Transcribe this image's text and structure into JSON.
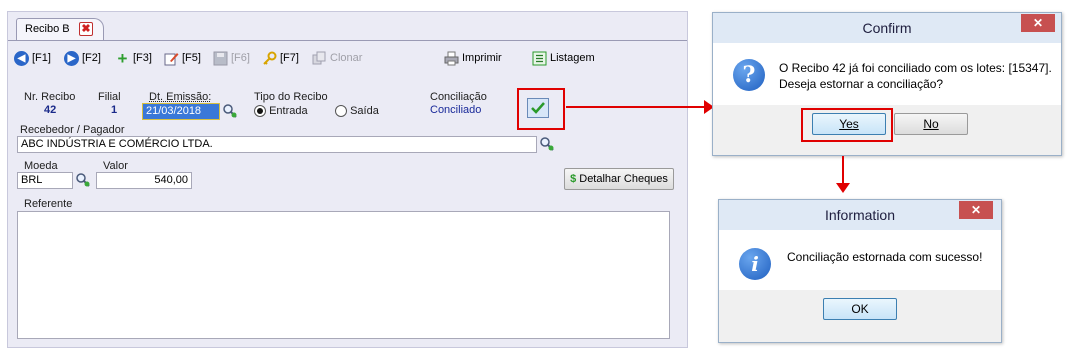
{
  "form": {
    "tab_label": "Recibo B",
    "toolbar": {
      "f1": "[F1]",
      "f2": "[F2]",
      "f3": "[F3]",
      "f5": "[F5]",
      "f6": "[F6]",
      "f7": "[F7]",
      "clonar": "Clonar",
      "imprimir": "Imprimir",
      "listagem": "Listagem"
    },
    "nr_recibo_label": "Nr. Recibo",
    "nr_recibo_value": "42",
    "filial_label": "Filial",
    "filial_value": "1",
    "dt_emissao_label": "Dt. Emissão:",
    "dt_emissao_value": "21/03/2018",
    "tipo_label": "Tipo do Recibo",
    "tipo_entrada": "Entrada",
    "tipo_saida": "Saída",
    "tipo_selected": "Entrada",
    "conciliacao_label": "Conciliação",
    "conciliacao_value": "Conciliado",
    "recebedor_label": "Recebedor / Pagador",
    "recebedor_value": "ABC INDÚSTRIA E COMÉRCIO LTDA.",
    "moeda_label": "Moeda",
    "moeda_value": "BRL",
    "valor_label": "Valor",
    "valor_value": "540,00",
    "detalhar_label": "Detalhar Cheques",
    "referente_label": "Referente",
    "referente_value": ""
  },
  "confirm_dialog": {
    "title": "Confirm",
    "message_line1": "O Recibo 42 já foi conciliado com os lotes: [15347].",
    "message_line2": "Deseja estornar a conciliação?",
    "yes_label": "Yes",
    "no_label": "No"
  },
  "info_dialog": {
    "title": "Information",
    "message": "Conciliação estornada com sucesso!",
    "ok_label": "OK"
  },
  "colors": {
    "annotation": "#e00000",
    "accent": "#1a2a8a"
  }
}
